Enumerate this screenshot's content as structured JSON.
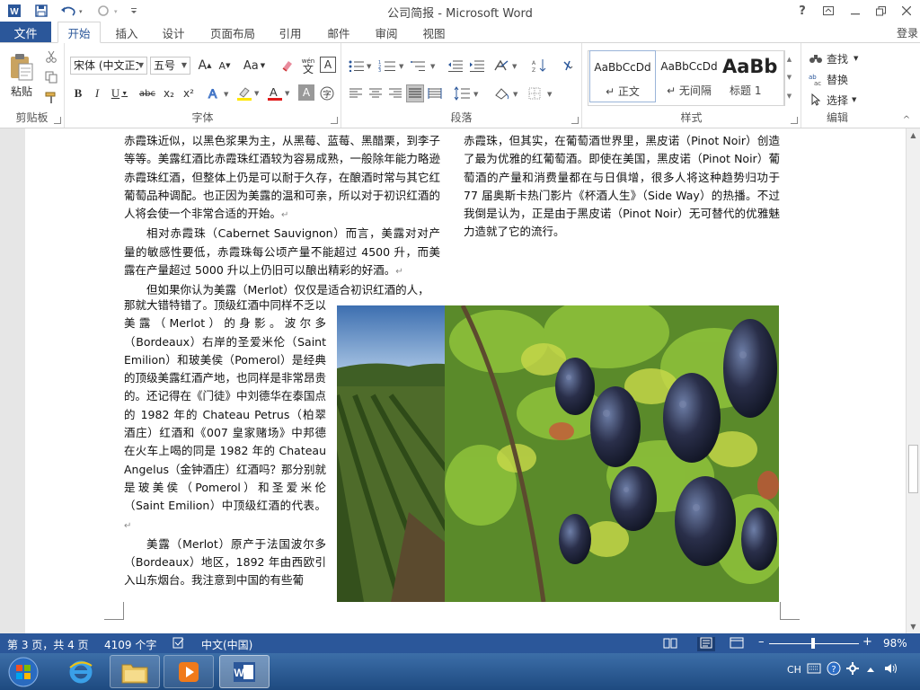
{
  "window": {
    "title": "公司简报 - Microsoft Word",
    "help": "?",
    "login": "登录"
  },
  "tabs": {
    "file": "文件",
    "items": [
      "开始",
      "插入",
      "设计",
      "页面布局",
      "引用",
      "邮件",
      "审阅",
      "视图"
    ],
    "active": "开始"
  },
  "ribbon": {
    "clipboard": {
      "paste": "粘贴",
      "label": "剪贴板"
    },
    "font": {
      "name": "宋体 (中文正文)",
      "size": "五号",
      "grow": "A",
      "shrink": "A",
      "case": "Aa",
      "phonetic": "wén",
      "border_char": "A",
      "bold": "B",
      "italic": "I",
      "underline": "U",
      "strike": "abc",
      "subscript": "x₂",
      "superscript": "x²",
      "label": "字体"
    },
    "paragraph": {
      "label": "段落"
    },
    "styles": {
      "items": [
        {
          "sample": "AaBbCcDd",
          "name": "↵ 正文"
        },
        {
          "sample": "AaBbCcDd",
          "name": "↵ 无间隔"
        },
        {
          "sample": "AaBb",
          "name": "标题 1"
        }
      ],
      "label": "样式"
    },
    "editing": {
      "find": "查找",
      "replace": "替换",
      "select": "选择",
      "label": "编辑"
    }
  },
  "document": {
    "left_col_top": "赤霞珠近似，以黑色浆果为主，从黑莓、蓝莓、黑醋栗，到李子等等。美露红酒比赤霞珠红酒较为容易成熟，一般除年能力略逊赤霞珠红酒，但整体上仍是可以耐于久存，在酿酒时常与其它红葡萄品种调配。也正因为美露的温和可亲，所以对于初识红酒的人将会使一个非常合适的开始。",
    "left_col_p2": "相对赤霞珠（Cabernet Sauvignon）而言，美露对对产量的敏感性要低，赤霞珠每公顷产量不能超过 4500 升，而美露在产量超过 5000 升以上仍旧可以酿出精彩的好酒。",
    "left_col_p3_first": "但如果你认为美露（Merlot）仅仅是适合初识红酒的人，",
    "left_col_p3_rest": "那就大错特错了。顶级红酒中同样不乏以美露（Merlot）的身影。波尔多（Bordeaux）右岸的圣爱米伦（Saint Emilion）和玻美侯（Pomerol）是经典的顶级美露红酒产地，也同样是非常昂贵的。还记得在《门徒》中刘德华在泰国点的 1982 年的 Chateau Petrus（柏翠酒庄）红酒和《007 皇家赌场》中邦德在火车上喝的同是 1982 年的 Chateau Angelus（金钟酒庄）红酒吗？那分别就是玻美侯（Pomerol）和圣爱米伦（Saint Emilion）中顶级红酒的代表。",
    "left_col_p4": "美露（Merlot）原产于法国波尔多（Bordeaux）地区，1892 年由西欧引入山东烟台。我注意到中国的有些葡",
    "right_col_top": "赤霞珠，但其实，在葡萄酒世界里，黑皮诺（Pinot Noir）创造了最为优雅的红葡萄酒。即使在美国，黑皮诺（Pinot Noir）葡萄酒的产量和消费量都在与日俱增，很多人将这种趋势归功于 77 届奥斯卡热门影片《杯酒人生》（Side Way）的热播。不过我倒是认为，正是由于黑皮诺（Pinot Noir）无可替代的优雅魅力造就了它的流行。",
    "para_mark": "↵"
  },
  "status": {
    "page": "第 3 页，共 4 页",
    "words": "4109 个字",
    "language": "中文(中国)",
    "zoom": "98%",
    "zoom_level": 0.49
  },
  "taskbar": {
    "tray_lang": "CH"
  },
  "colors": {
    "accent": "#2b579a",
    "ribbon_bg": "#ffffff",
    "doc_bg": "#e6e6e6"
  }
}
